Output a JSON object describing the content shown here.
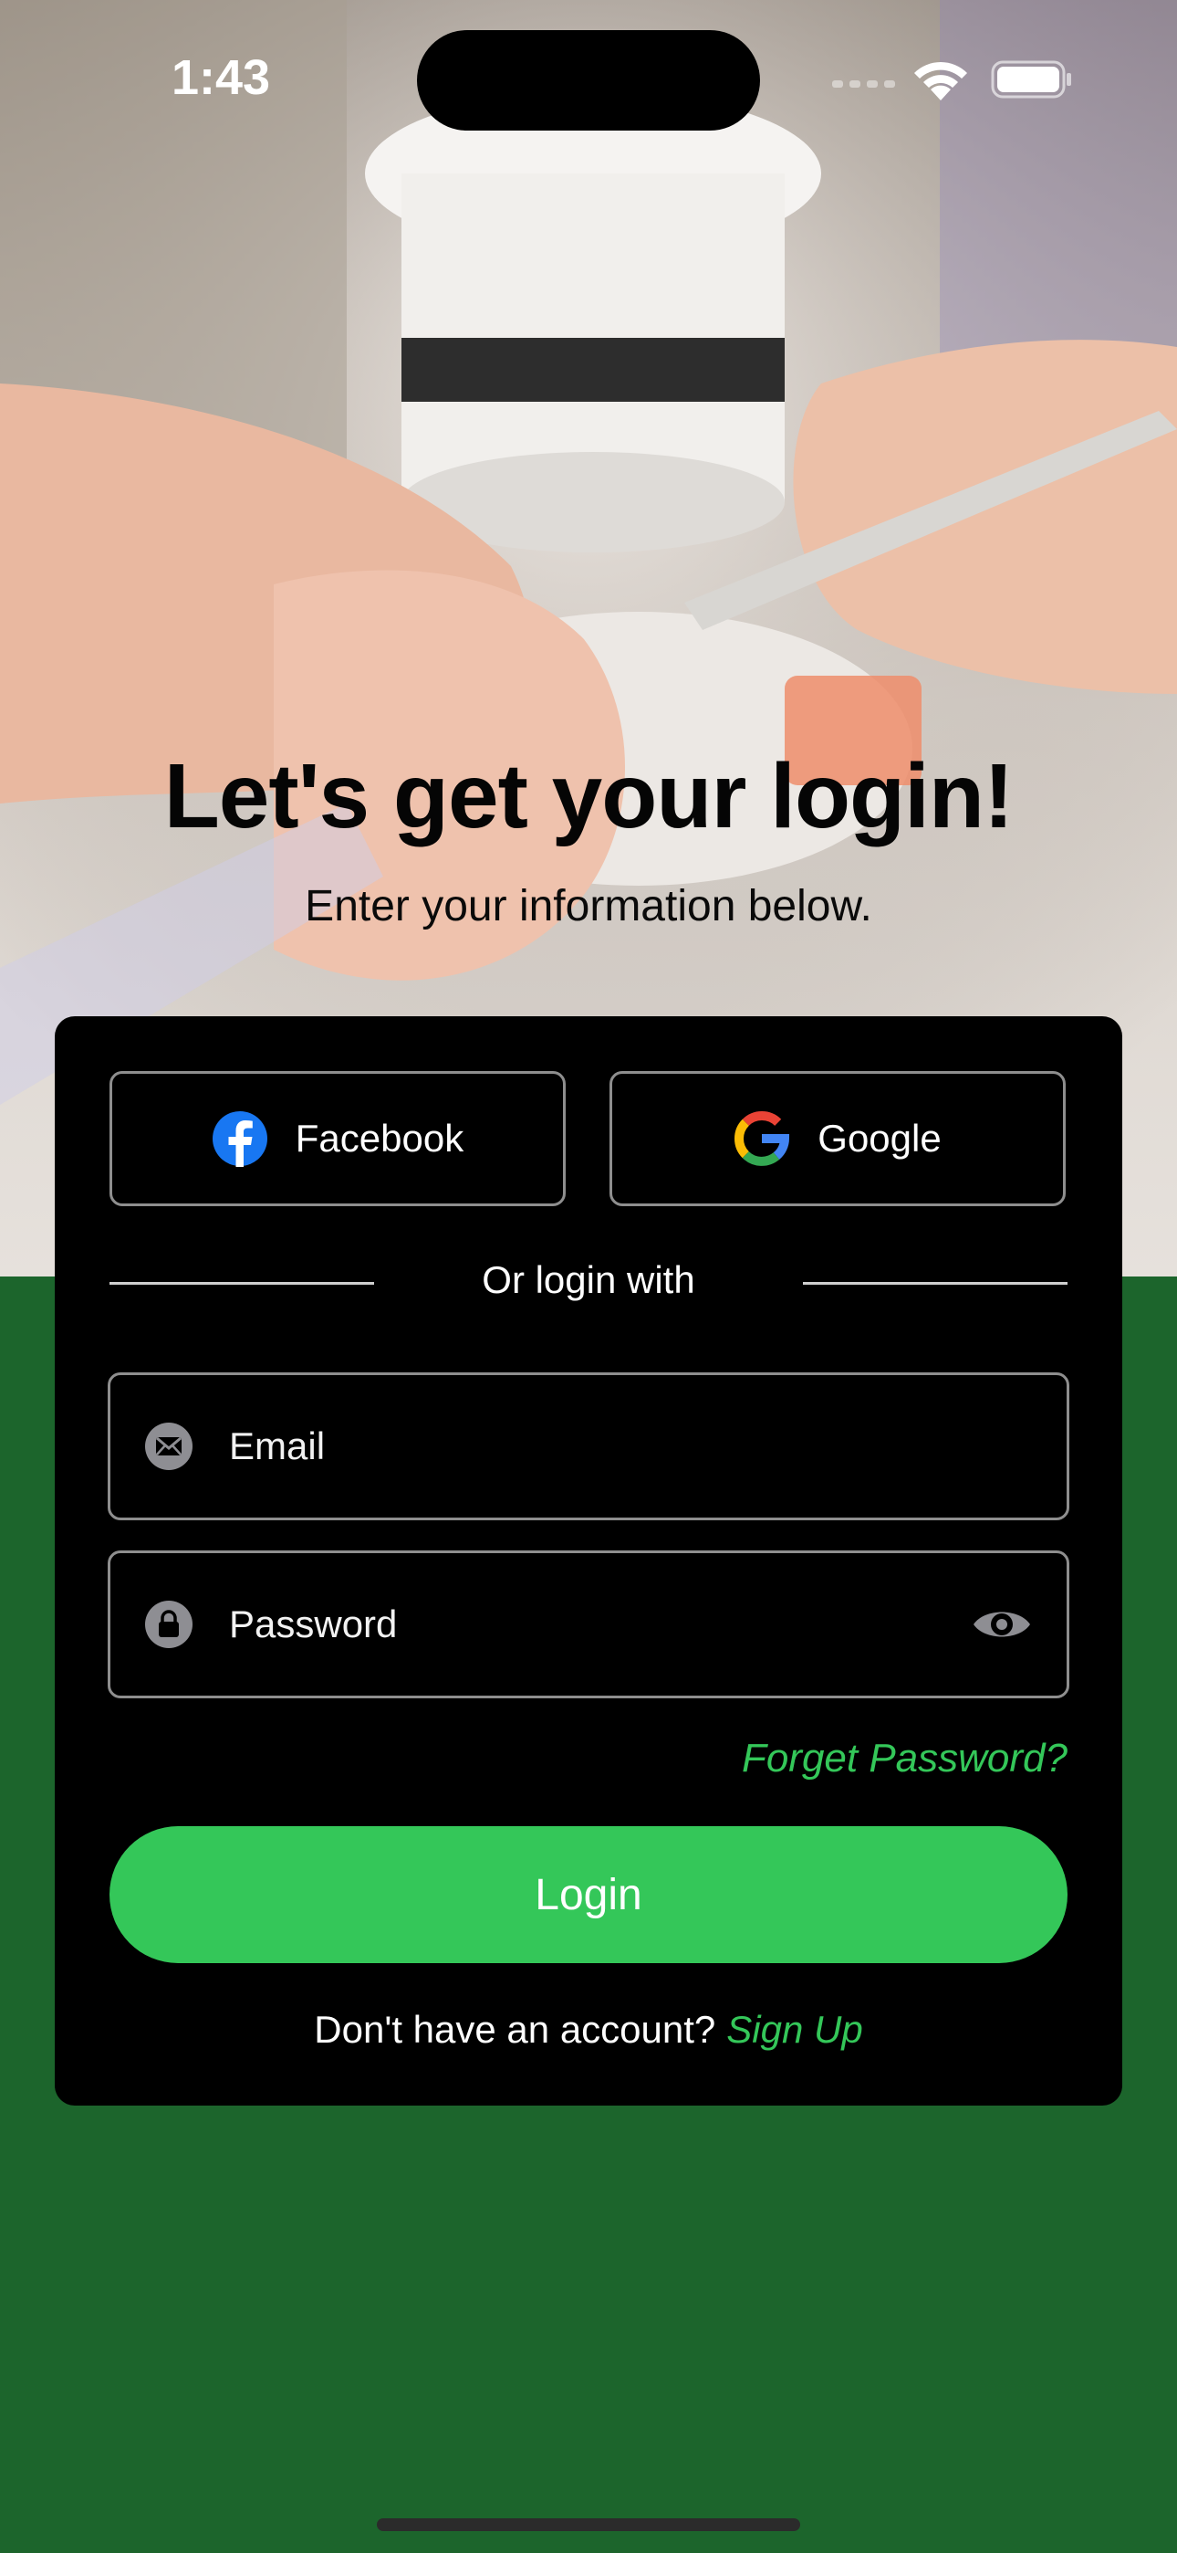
{
  "status_bar": {
    "time": "1:43"
  },
  "header": {
    "title": "Let's get your login!",
    "subtitle": "Enter your information below."
  },
  "social": {
    "facebook_label": "Facebook",
    "google_label": "Google"
  },
  "divider": {
    "label": "Or login with"
  },
  "form": {
    "email_placeholder": "Email",
    "password_placeholder": "Password",
    "forgot_label": "Forget Password?",
    "login_label": "Login"
  },
  "signup": {
    "prompt": "Don't have an account?",
    "link": "Sign Up"
  },
  "icons": {
    "email": "envelope-icon",
    "password": "lock-icon",
    "toggle": "eye-icon",
    "facebook": "facebook-icon",
    "google": "google-icon"
  },
  "colors": {
    "accent": "#34c759",
    "background": "#1c652c",
    "card": "#000000",
    "facebook": "#1877f2"
  }
}
